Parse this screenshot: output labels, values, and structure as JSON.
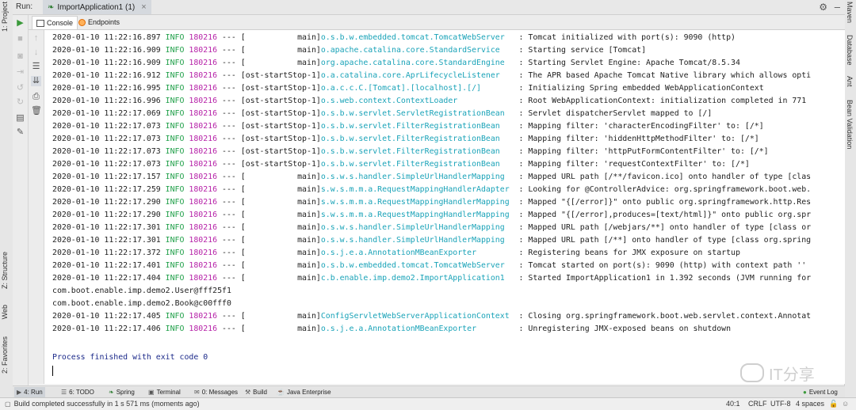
{
  "left_strip": {
    "project_label": "1: Project",
    "structure_label": "Z: Structure",
    "web_label": "Web",
    "favorites_label": "2: Favorites"
  },
  "right_strip": {
    "maven_label": "Maven",
    "database_label": "Database",
    "ant_label": "Ant",
    "bean_validation_label": "Bean Validation"
  },
  "run_panel": {
    "run_label": "Run:",
    "tab_title": "ImportApplication1 (1)",
    "console_tab": "Console",
    "endpoints_tab": "Endpoints"
  },
  "log": [
    {
      "ts": "2020-01-10 11:22:16.897",
      "level": "INFO",
      "pid": "180216",
      "sep": "---",
      "thread": "[           main]",
      "logger": "o.s.b.w.embedded.tomcat.TomcatWebServer",
      "msg": ": Tomcat initialized with port(s): 9090 (http)"
    },
    {
      "ts": "2020-01-10 11:22:16.909",
      "level": "INFO",
      "pid": "180216",
      "sep": "---",
      "thread": "[           main]",
      "logger": "o.apache.catalina.core.StandardService",
      "msg": ": Starting service [Tomcat]"
    },
    {
      "ts": "2020-01-10 11:22:16.909",
      "level": "INFO",
      "pid": "180216",
      "sep": "---",
      "thread": "[           main]",
      "logger": "org.apache.catalina.core.StandardEngine",
      "msg": ": Starting Servlet Engine: Apache Tomcat/8.5.34"
    },
    {
      "ts": "2020-01-10 11:22:16.912",
      "level": "INFO",
      "pid": "180216",
      "sep": "---",
      "thread": "[ost-startStop-1]",
      "logger": "o.a.catalina.core.AprLifecycleListener",
      "msg": ": The APR based Apache Tomcat Native library which allows opti"
    },
    {
      "ts": "2020-01-10 11:22:16.995",
      "level": "INFO",
      "pid": "180216",
      "sep": "---",
      "thread": "[ost-startStop-1]",
      "logger": "o.a.c.c.C.[Tomcat].[localhost].[/]",
      "msg": ": Initializing Spring embedded WebApplicationContext"
    },
    {
      "ts": "2020-01-10 11:22:16.996",
      "level": "INFO",
      "pid": "180216",
      "sep": "---",
      "thread": "[ost-startStop-1]",
      "logger": "o.s.web.context.ContextLoader",
      "msg": ": Root WebApplicationContext: initialization completed in 771"
    },
    {
      "ts": "2020-01-10 11:22:17.069",
      "level": "INFO",
      "pid": "180216",
      "sep": "---",
      "thread": "[ost-startStop-1]",
      "logger": "o.s.b.w.servlet.ServletRegistrationBean",
      "msg": ": Servlet dispatcherServlet mapped to [/]"
    },
    {
      "ts": "2020-01-10 11:22:17.073",
      "level": "INFO",
      "pid": "180216",
      "sep": "---",
      "thread": "[ost-startStop-1]",
      "logger": "o.s.b.w.servlet.FilterRegistrationBean",
      "msg": ": Mapping filter: 'characterEncodingFilter' to: [/*]"
    },
    {
      "ts": "2020-01-10 11:22:17.073",
      "level": "INFO",
      "pid": "180216",
      "sep": "---",
      "thread": "[ost-startStop-1]",
      "logger": "o.s.b.w.servlet.FilterRegistrationBean",
      "msg": ": Mapping filter: 'hiddenHttpMethodFilter' to: [/*]"
    },
    {
      "ts": "2020-01-10 11:22:17.073",
      "level": "INFO",
      "pid": "180216",
      "sep": "---",
      "thread": "[ost-startStop-1]",
      "logger": "o.s.b.w.servlet.FilterRegistrationBean",
      "msg": ": Mapping filter: 'httpPutFormContentFilter' to: [/*]"
    },
    {
      "ts": "2020-01-10 11:22:17.073",
      "level": "INFO",
      "pid": "180216",
      "sep": "---",
      "thread": "[ost-startStop-1]",
      "logger": "o.s.b.w.servlet.FilterRegistrationBean",
      "msg": ": Mapping filter: 'requestContextFilter' to: [/*]"
    },
    {
      "ts": "2020-01-10 11:22:17.157",
      "level": "INFO",
      "pid": "180216",
      "sep": "---",
      "thread": "[           main]",
      "logger": "o.s.w.s.handler.SimpleUrlHandlerMapping",
      "msg": ": Mapped URL path [/**/favicon.ico] onto handler of type [clas"
    },
    {
      "ts": "2020-01-10 11:22:17.259",
      "level": "INFO",
      "pid": "180216",
      "sep": "---",
      "thread": "[           main]",
      "logger": "s.w.s.m.m.a.RequestMappingHandlerAdapter",
      "msg": ": Looking for @ControllerAdvice: org.springframework.boot.web."
    },
    {
      "ts": "2020-01-10 11:22:17.290",
      "level": "INFO",
      "pid": "180216",
      "sep": "---",
      "thread": "[           main]",
      "logger": "s.w.s.m.m.a.RequestMappingHandlerMapping",
      "msg": ": Mapped \"{[/error]}\" onto public org.springframework.http.Res"
    },
    {
      "ts": "2020-01-10 11:22:17.290",
      "level": "INFO",
      "pid": "180216",
      "sep": "---",
      "thread": "[           main]",
      "logger": "s.w.s.m.m.a.RequestMappingHandlerMapping",
      "msg": ": Mapped \"{[/error],produces=[text/html]}\" onto public org.spr"
    },
    {
      "ts": "2020-01-10 11:22:17.301",
      "level": "INFO",
      "pid": "180216",
      "sep": "---",
      "thread": "[           main]",
      "logger": "o.s.w.s.handler.SimpleUrlHandlerMapping",
      "msg": ": Mapped URL path [/webjars/**] onto handler of type [class or"
    },
    {
      "ts": "2020-01-10 11:22:17.301",
      "level": "INFO",
      "pid": "180216",
      "sep": "---",
      "thread": "[           main]",
      "logger": "o.s.w.s.handler.SimpleUrlHandlerMapping",
      "msg": ": Mapped URL path [/**] onto handler of type [class org.spring"
    },
    {
      "ts": "2020-01-10 11:22:17.372",
      "level": "INFO",
      "pid": "180216",
      "sep": "---",
      "thread": "[           main]",
      "logger": "o.s.j.e.a.AnnotationMBeanExporter",
      "msg": ": Registering beans for JMX exposure on startup"
    },
    {
      "ts": "2020-01-10 11:22:17.401",
      "level": "INFO",
      "pid": "180216",
      "sep": "---",
      "thread": "[           main]",
      "logger": "o.s.b.w.embedded.tomcat.TomcatWebServer",
      "msg": ": Tomcat started on port(s): 9090 (http) with context path ''"
    },
    {
      "ts": "2020-01-10 11:22:17.404",
      "level": "INFO",
      "pid": "180216",
      "sep": "---",
      "thread": "[           main]",
      "logger": "c.b.enable.imp.demo2.ImportApplication1",
      "msg": ": Started ImportApplication1 in 1.392 seconds (JVM running for"
    }
  ],
  "plain_lines": [
    "com.boot.enable.imp.demo2.User@fff25f1",
    "com.boot.enable.imp.demo2.Book@c00fff0"
  ],
  "log2": [
    {
      "ts": "2020-01-10 11:22:17.405",
      "level": "INFO",
      "pid": "180216",
      "sep": "---",
      "thread": "[           main]",
      "logger": "ConfigServletWebServerApplicationContext",
      "msg": ": Closing org.springframework.boot.web.servlet.context.Annotat"
    },
    {
      "ts": "2020-01-10 11:22:17.406",
      "level": "INFO",
      "pid": "180216",
      "sep": "---",
      "thread": "[           main]",
      "logger": "o.s.j.e.a.AnnotationMBeanExporter",
      "msg": ": Unregistering JMX-exposed beans on shutdown"
    }
  ],
  "process_finished": "Process finished with exit code 0",
  "watermark": "IT分享",
  "tool_windows": [
    "4: Run",
    "6: TODO",
    "Spring",
    "Terminal",
    "0: Messages",
    "Build",
    "Java Enterprise"
  ],
  "event_log": "Event Log",
  "status": {
    "message": "Build completed successfully in 1 s 571 ms (moments ago)",
    "position": "40:1",
    "line_sep": "CRLF",
    "encoding": "UTF-8",
    "indent": "4 spaces"
  },
  "colors": {
    "level": "#21a04a",
    "pid": "#b622a8",
    "logger": "#1aa3b8",
    "exit_message": "#1c2a8a"
  }
}
